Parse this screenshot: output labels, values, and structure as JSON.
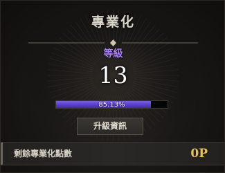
{
  "header": {
    "title": "專業化"
  },
  "level": {
    "label": "等級",
    "value": "13"
  },
  "progress": {
    "percent": 85.13,
    "text": "85.13%"
  },
  "buttons": {
    "upgrade_info_label": "升級資訊"
  },
  "points": {
    "label": "剩餘專業化點數",
    "value": "0P"
  },
  "colors": {
    "accent_purple": "#a97ef0",
    "progress_fill": "#5a3ec9",
    "points_gold": "#e6c15c"
  }
}
